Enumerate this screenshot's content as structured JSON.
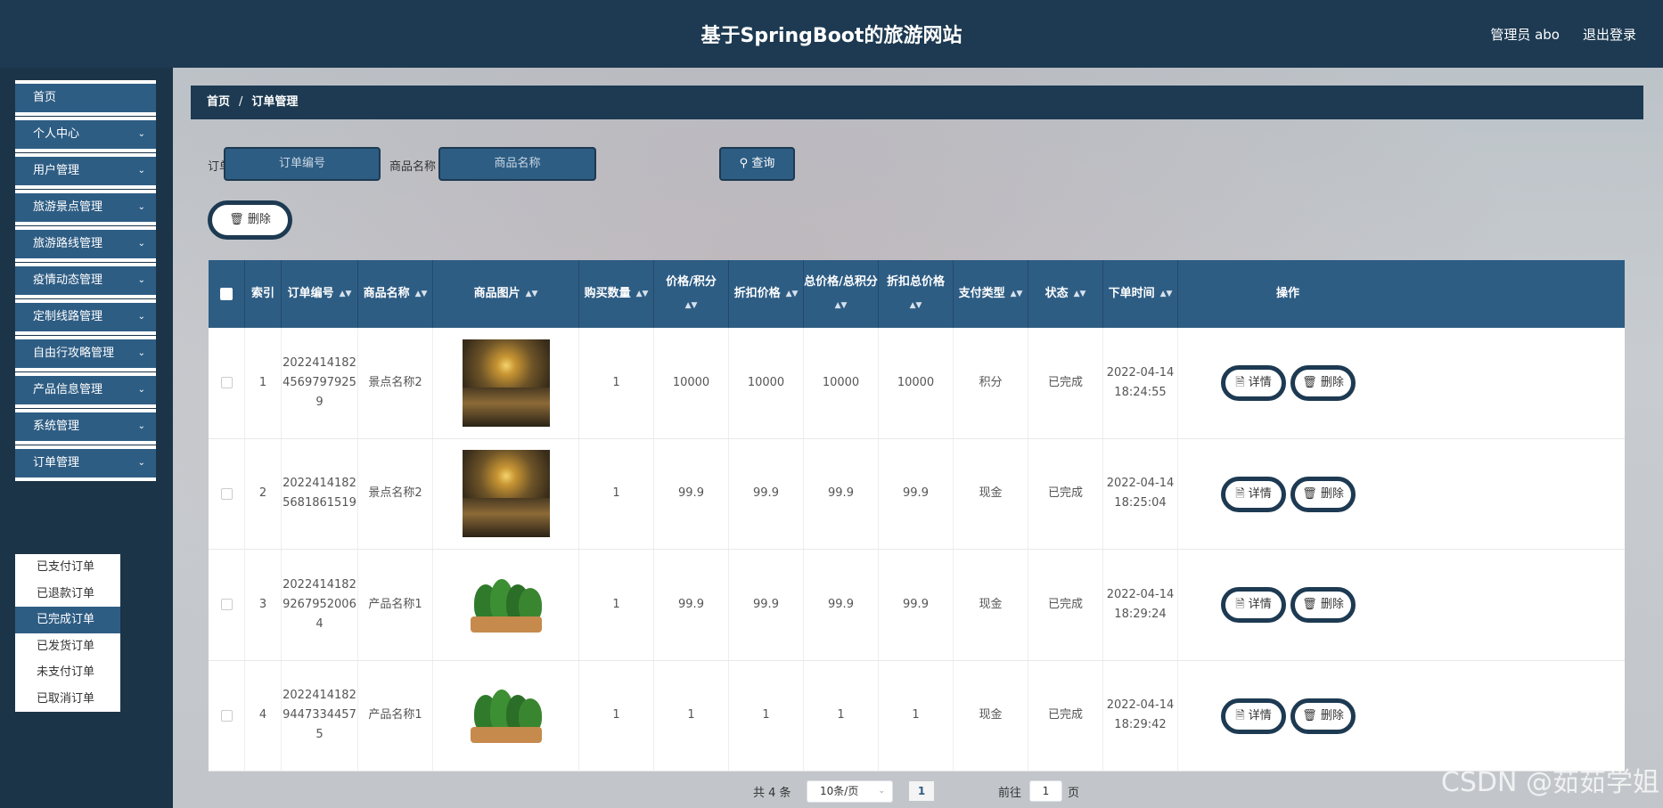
{
  "header": {
    "title": "基于SpringBoot的旅游网站",
    "user": "管理员 abo",
    "logout": "退出登录"
  },
  "sidebar": {
    "items": [
      {
        "label": "首页"
      },
      {
        "label": "个人中心"
      },
      {
        "label": "用户管理"
      },
      {
        "label": "旅游景点管理"
      },
      {
        "label": "旅游路线管理"
      },
      {
        "label": "疫情动态管理"
      },
      {
        "label": "定制线路管理"
      },
      {
        "label": "自由行攻略管理"
      },
      {
        "label": "产品信息管理"
      },
      {
        "label": "系统管理"
      },
      {
        "label": "订单管理"
      }
    ],
    "submenu": [
      {
        "label": "已支付订单"
      },
      {
        "label": "已退款订单"
      },
      {
        "label": "已完成订单"
      },
      {
        "label": "已发货订单"
      },
      {
        "label": "未支付订单"
      },
      {
        "label": "已取消订单"
      }
    ],
    "active_sub": "已完成订单"
  },
  "breadcrumb": {
    "home": "首页",
    "sep": "/",
    "current": "订单管理"
  },
  "search": {
    "order_label": "订单编号",
    "order_placeholder": "订单编号",
    "product_label": "商品名称",
    "product_placeholder": "商品名称",
    "query": "查询"
  },
  "toolbar": {
    "delete": "删除"
  },
  "table": {
    "headers": [
      "索引",
      "订单编号",
      "商品名称",
      "商品图片",
      "购买数量",
      "价格/积分",
      "折扣价格",
      "总价格/总积分",
      "折扣总价格",
      "支付类型",
      "状态",
      "下单时间",
      "操作"
    ],
    "rows": [
      {
        "index": "1",
        "order_no": "20224141824569797925 9",
        "order_no_lines": [
          "2022414182",
          "4569797925",
          "9"
        ],
        "name": "景点名称2",
        "image": "sunset",
        "qty": "1",
        "price": "10000",
        "discount": "10000",
        "total": "10000",
        "discount_total": "10000",
        "pay_type": "积分",
        "status": "已完成",
        "date": "2022-04-14",
        "time": "18:24:55"
      },
      {
        "index": "2",
        "order_no_lines": [
          "2022414182",
          "5681861519"
        ],
        "name": "景点名称2",
        "image": "sunset",
        "qty": "1",
        "price": "99.9",
        "discount": "99.9",
        "total": "99.9",
        "discount_total": "99.9",
        "pay_type": "现金",
        "status": "已完成",
        "date": "2022-04-14",
        "time": "18:25:04"
      },
      {
        "index": "3",
        "order_no_lines": [
          "2022414182",
          "9267952006",
          "4"
        ],
        "name": "产品名称1",
        "image": "vegetable",
        "qty": "1",
        "price": "99.9",
        "discount": "99.9",
        "total": "99.9",
        "discount_total": "99.9",
        "pay_type": "现金",
        "status": "已完成",
        "date": "2022-04-14",
        "time": "18:29:24"
      },
      {
        "index": "4",
        "order_no_lines": [
          "2022414182",
          "9447334457",
          "5"
        ],
        "name": "产品名称1",
        "image": "vegetable",
        "qty": "1",
        "price": "1",
        "discount": "1",
        "total": "1",
        "discount_total": "1",
        "pay_type": "现金",
        "status": "已完成",
        "date": "2022-04-14",
        "time": "18:29:42"
      }
    ],
    "actions": {
      "detail": "详情",
      "delete": "删除"
    }
  },
  "pagination": {
    "total": "共 4 条",
    "page_size": "10条/页",
    "current": "1",
    "goto": "前往",
    "goto_value": "1",
    "unit": "页"
  },
  "watermark": "CSDN @茹茹学姐",
  "colors": {
    "primary": "#2e5d84",
    "dark": "#1d3a52"
  }
}
